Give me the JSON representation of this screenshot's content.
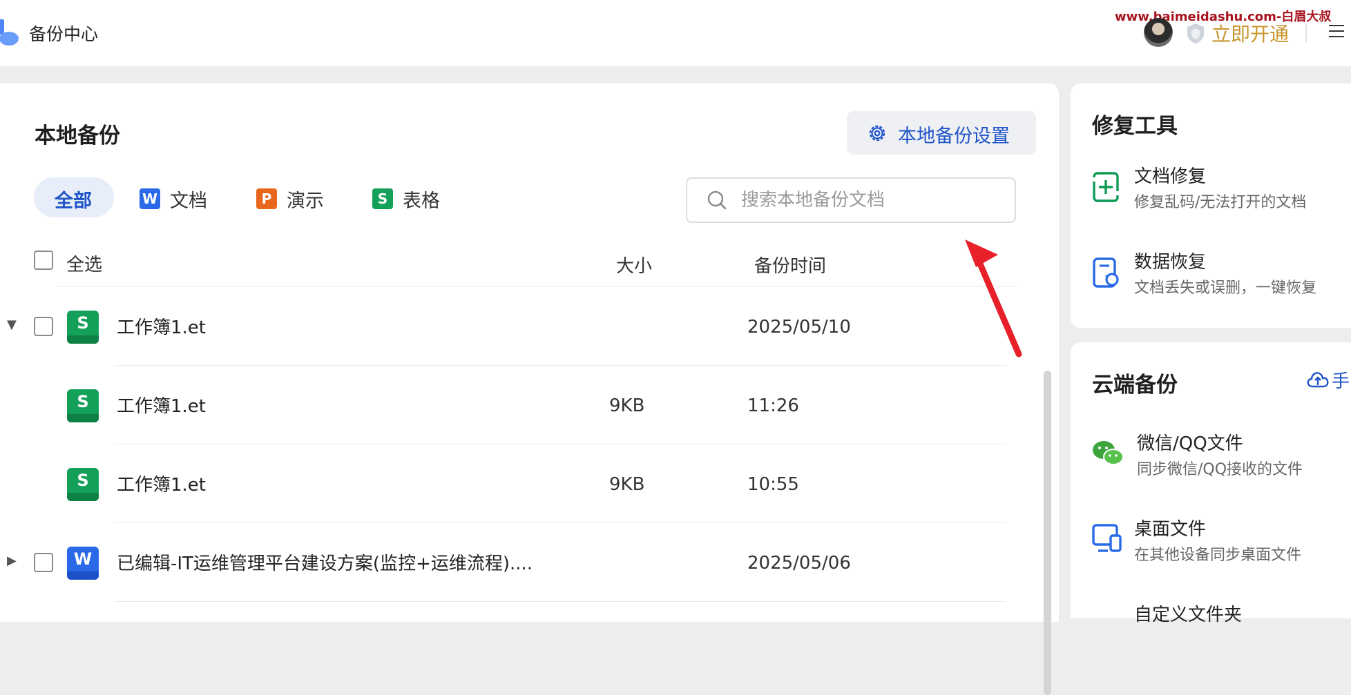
{
  "app": {
    "title": "备份中心"
  },
  "header": {
    "watermark": "www.baimeidashu.com-白眉大叔",
    "upgrade_label": "立即开通"
  },
  "main": {
    "title": "本地备份",
    "settings_label": "本地备份设置",
    "tabs": [
      {
        "label": "全部",
        "active": true
      },
      {
        "label": "文档",
        "icon": "W"
      },
      {
        "label": "演示",
        "icon": "P"
      },
      {
        "label": "表格",
        "icon": "S"
      }
    ],
    "search_placeholder": "搜索本地备份文档",
    "columns": {
      "select_all": "全选",
      "size": "大小",
      "time": "备份时间"
    },
    "rows": [
      {
        "icon": "S",
        "name": "工作簿1.et",
        "size": "",
        "time": "2025/05/10",
        "expander": "▼"
      },
      {
        "icon": "S",
        "name": "工作簿1.et",
        "size": "9KB",
        "time": "11:26"
      },
      {
        "icon": "S",
        "name": "工作簿1.et",
        "size": "9KB",
        "time": "10:55"
      },
      {
        "icon": "W",
        "name": "已编辑-IT运维管理平台建设方案(监控+运维流程)....",
        "size": "",
        "time": "2025/05/06",
        "expander": "▶"
      }
    ]
  },
  "repair_tools": {
    "title": "修复工具",
    "items": [
      {
        "title": "文档修复",
        "desc": "修复乱码/无法打开的文档",
        "icon": "doc-repair-icon"
      },
      {
        "title": "数据恢复",
        "desc": "文档丢失或误删，一键恢复",
        "icon": "data-recovery-icon"
      }
    ]
  },
  "cloud_backup": {
    "title": "云端备份",
    "manual_label": "手",
    "items": [
      {
        "title": "微信/QQ文件",
        "desc": "同步微信/QQ接收的文件",
        "icon": "wechat-icon"
      },
      {
        "title": "桌面文件",
        "desc": "在其他设备同步桌面文件",
        "icon": "desktop-icon"
      },
      {
        "title": "自定义文件夹",
        "desc": "",
        "icon": "folder-icon"
      }
    ]
  },
  "colors": {
    "accent": "#1f53c8",
    "gold": "#c8962c",
    "sheet": "#15a05a",
    "word": "#2a6ae8",
    "ppt": "#e9661d",
    "arrow": "#e8202a"
  }
}
